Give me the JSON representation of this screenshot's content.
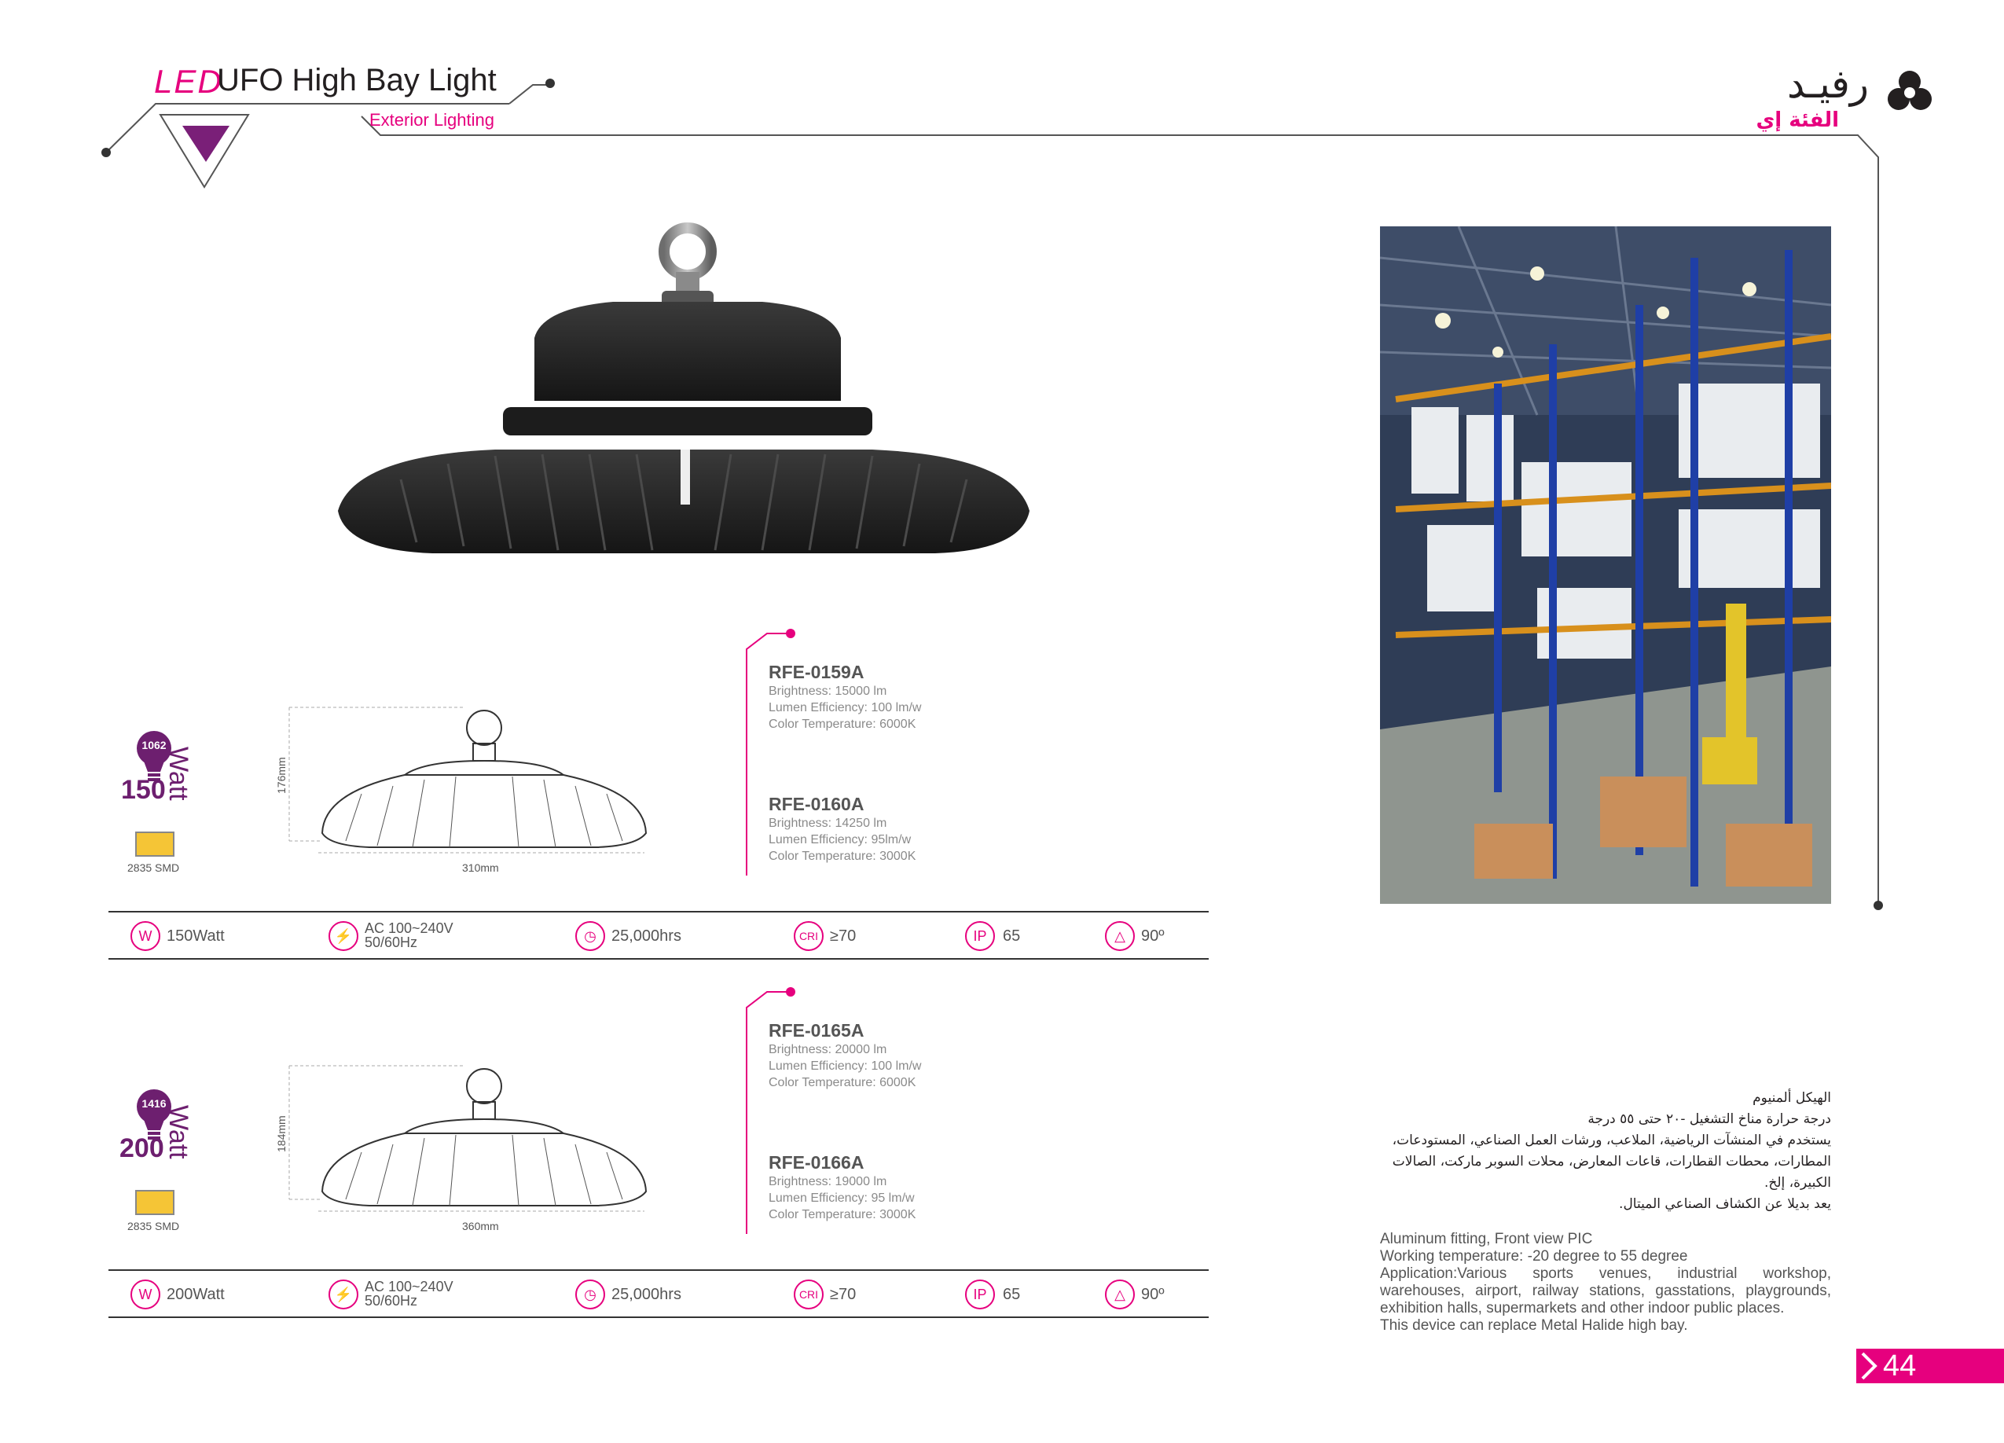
{
  "header": {
    "led": "LED",
    "title": "UFO High Bay Light",
    "subtitle": "Exterior Lighting",
    "logo_ar": "رفيـد",
    "logo_ar_sub": "الفئة إي"
  },
  "products": [
    {
      "watt_number": "150",
      "watt_word": "Watt",
      "bulb_number": "1062",
      "smd": "2835 SMD",
      "dim_height": "176mm",
      "dim_width": "310mm",
      "models": [
        {
          "name": "RFE-0159A",
          "brightness": "Brightness: 15000 lm",
          "efficiency": "Lumen Efficiency: 100 lm/w",
          "color_temp": "Color Temperature: 6000K"
        },
        {
          "name": "RFE-0160A",
          "brightness": "Brightness: 14250 lm",
          "efficiency": "Lumen Efficiency: 95lm/w",
          "color_temp": "Color Temperature: 3000K"
        }
      ],
      "specs": {
        "watt_icon": "W",
        "watt": "150Watt",
        "voltage_1": "AC 100~240V",
        "voltage_2": "50/60Hz",
        "life": "25,000hrs",
        "cri_icon": "CRI",
        "cri": "≥70",
        "ip_icon": "IP",
        "ip": "65",
        "angle": "90º"
      }
    },
    {
      "watt_number": "200",
      "watt_word": "Watt",
      "bulb_number": "1416",
      "smd": "2835 SMD",
      "dim_height": "184mm",
      "dim_width": "360mm",
      "models": [
        {
          "name": "RFE-0165A",
          "brightness": "Brightness: 20000 lm",
          "efficiency": "Lumen Efficiency: 100 lm/w",
          "color_temp": "Color Temperature: 6000K"
        },
        {
          "name": "RFE-0166A",
          "brightness": "Brightness: 19000 lm",
          "efficiency": "Lumen Efficiency: 95 lm/w",
          "color_temp": "Color Temperature: 3000K"
        }
      ],
      "specs": {
        "watt_icon": "W",
        "watt": "200Watt",
        "voltage_1": "AC 100~240V",
        "voltage_2": "50/60Hz",
        "life": "25,000hrs",
        "cri_icon": "CRI",
        "cri": "≥70",
        "ip_icon": "IP",
        "ip": "65",
        "angle": "90º"
      }
    }
  ],
  "description": {
    "arabic": [
      "الهيكل ألمنيوم",
      "درجة حرارة مناخ التشغيل -٢٠ حتى ٥٥ درجة",
      "يستخدم في المنشآت الرياضية، الملاعب، ورشات العمل الصناعي، المستودعات،",
      "المطارات، محطات القطارات، قاعات المعارض، محلات السوبر ماركت، الصالات",
      "الكبيرة، إلخ.",
      "يعد بديلا عن الكشاف الصناعي الميتال."
    ],
    "english": [
      "Aluminum fitting, Front view PIC",
      "Working temperature: -20 degree to 55 degree",
      "Application:Various sports venues, industrial workshop, warehouses, airport, railway stations, gasstations, playgrounds, exhibition halls, supermarkets and other indoor public places.",
      "This device can replace Metal Halide high bay."
    ]
  },
  "page_number": "44",
  "colors": {
    "accent": "#e6007e",
    "purple": "#6d1f6f",
    "text": "#231f20"
  }
}
